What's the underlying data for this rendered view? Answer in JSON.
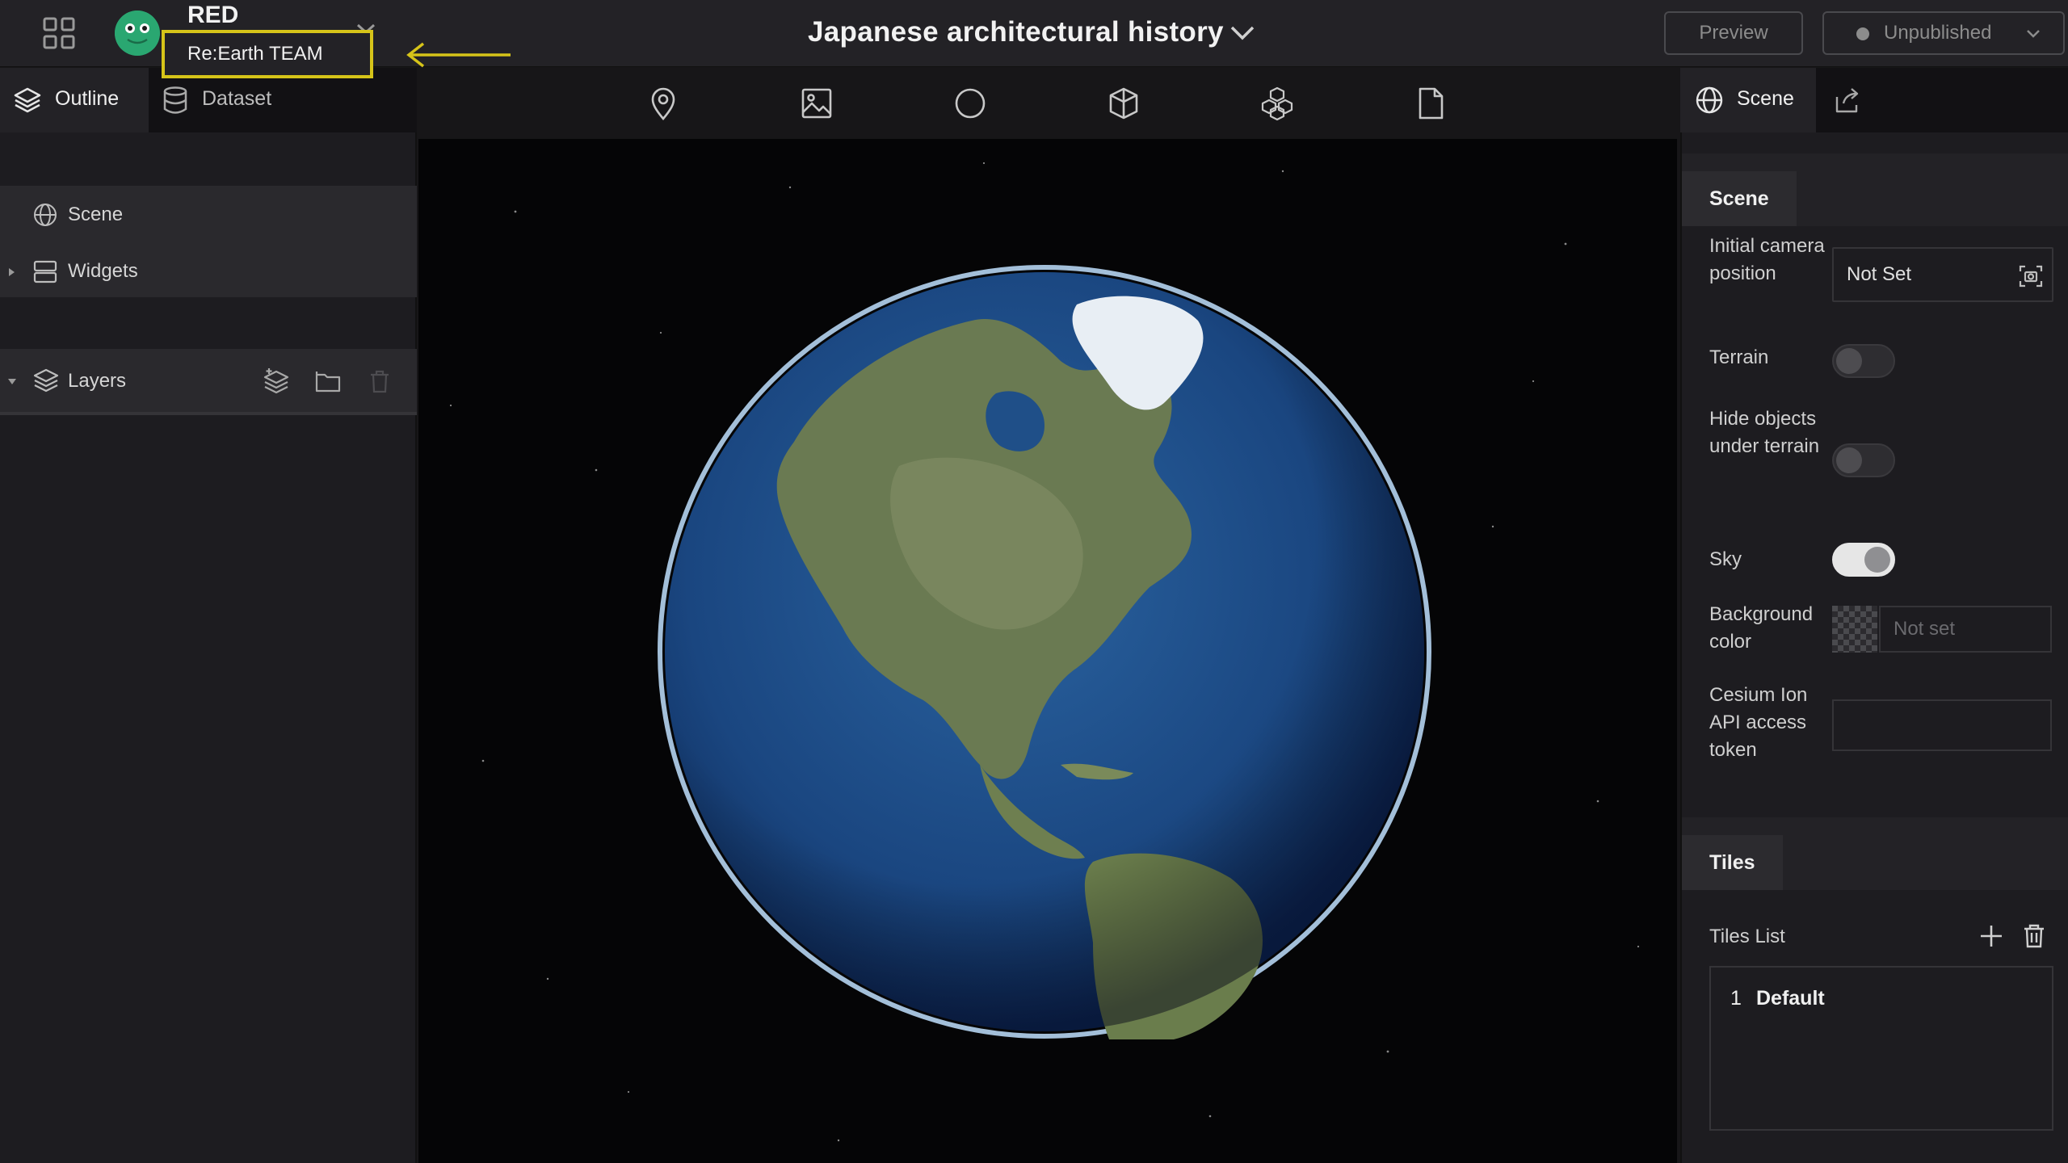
{
  "header": {
    "workspace_name": "RED",
    "team_name": "Re:Earth TEAM",
    "project_title": "Japanese architectural history",
    "preview_label": "Preview",
    "publish_status": "Unpublished"
  },
  "left_panel": {
    "tabs": [
      {
        "label": "Outline",
        "icon": "layers-icon",
        "active": true
      },
      {
        "label": "Dataset",
        "icon": "database-icon",
        "active": false
      }
    ],
    "items": [
      {
        "label": "Scene",
        "icon": "globe-icon"
      },
      {
        "label": "Widgets",
        "icon": "widgets-icon"
      }
    ],
    "layers_label": "Layers"
  },
  "toolbar": {
    "tools": [
      "map-pin-icon",
      "image-icon",
      "circle-icon",
      "cube-icon",
      "cubes-icon",
      "file-icon"
    ]
  },
  "right_panel": {
    "tabs": [
      {
        "label": "Scene",
        "icon": "globe-icon",
        "active": true
      },
      {
        "label": "",
        "icon": "publish-icon",
        "active": false
      }
    ],
    "scene_group": {
      "title": "Scene",
      "camera_label": "Initial camera position",
      "camera_value": "Not Set",
      "terrain_label": "Terrain",
      "terrain_on": false,
      "hide_objects_label": "Hide objects under terrain",
      "hide_objects_on": false,
      "sky_label": "Sky",
      "sky_on": true,
      "bg_color_label": "Background color",
      "bg_color_placeholder": "Not set",
      "cesium_label": "Cesium Ion API access token",
      "cesium_value": ""
    },
    "tiles_group": {
      "title": "Tiles",
      "list_label": "Tiles List",
      "items": [
        {
          "index": "1",
          "name": "Default"
        }
      ]
    }
  },
  "colors": {
    "highlight_box": "#d6c419",
    "avatar": "#2aa771",
    "panel_bg": "#1d1c20",
    "header_bg": "#232226"
  }
}
